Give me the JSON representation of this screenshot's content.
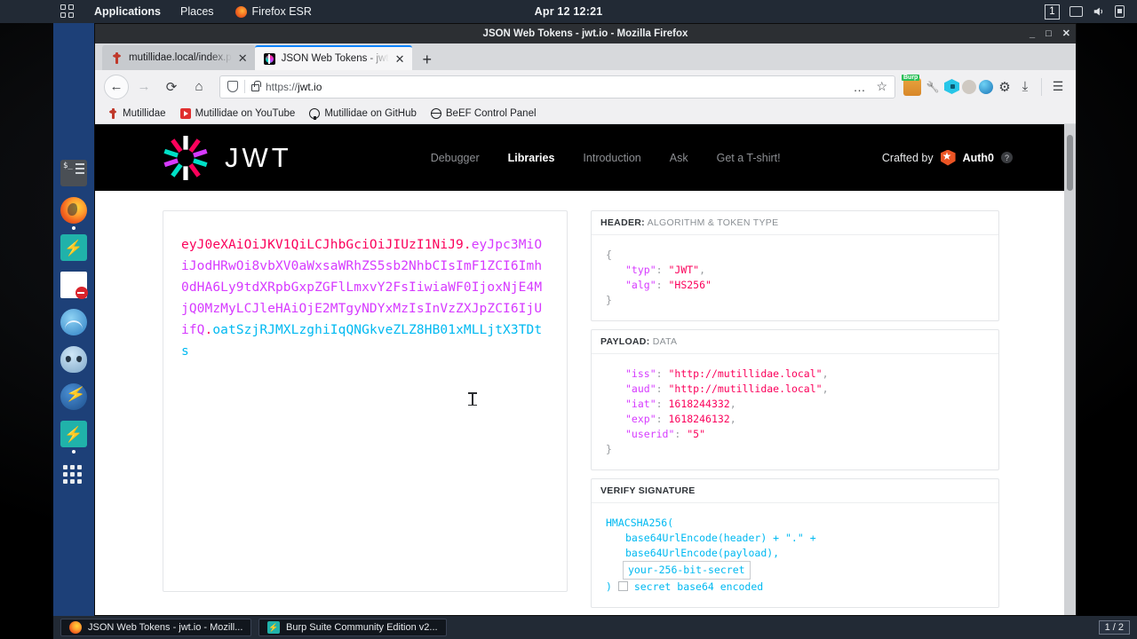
{
  "topbar": {
    "apps_icon": "apps-grid-icon",
    "menu_applications": "Applications",
    "menu_places": "Places",
    "menu_firefox": "Firefox ESR",
    "clock": "Apr 12  12:21",
    "workspace_badge": "1",
    "icons": [
      "display-icon",
      "volume-icon",
      "power-icon"
    ]
  },
  "dock": {
    "items": [
      {
        "name": "terminal",
        "label": "Terminal"
      },
      {
        "name": "firefox",
        "label": "Firefox ESR"
      },
      {
        "name": "burpsuite",
        "label": "Burp Suite"
      },
      {
        "name": "document-blocked",
        "label": "Document"
      },
      {
        "name": "wireshark",
        "label": "Wireshark"
      },
      {
        "name": "beef",
        "label": "BeEF"
      },
      {
        "name": "hydra",
        "label": "Hydra"
      },
      {
        "name": "burpsuite-2",
        "label": "Burp Suite"
      },
      {
        "name": "show-applications",
        "label": "Show Applications"
      }
    ]
  },
  "window": {
    "title": "JSON Web Tokens - jwt.io - Mozilla Firefox",
    "minimize": "_",
    "maximize": "□",
    "close": "✕"
  },
  "tabs": [
    {
      "title": "mutillidae.local/index.p",
      "favicon": "mutillidae-icon",
      "active": false
    },
    {
      "title": "JSON Web Tokens - jwt",
      "favicon": "jwt-icon",
      "active": true
    }
  ],
  "tab_new_label": "+",
  "navbar": {
    "back": "←",
    "forward": "→",
    "reload": "⟳",
    "home": "⌂",
    "url_scheme": "https://",
    "url_host": "jwt.io",
    "page_actions": "…",
    "bookmark_star": "☆",
    "extensions": [
      "burp-icon",
      "wrench-icon",
      "cube-icon",
      "cookie-icon",
      "globe-icon",
      "gear-icon",
      "download-icon"
    ],
    "app_menu": "☰"
  },
  "bookmarks": [
    {
      "label": "Mutillidae",
      "icon": "mutillidae-icon"
    },
    {
      "label": "Mutillidae on YouTube",
      "icon": "youtube-icon"
    },
    {
      "label": "Mutillidae on GitHub",
      "icon": "github-icon"
    },
    {
      "label": "BeEF Control Panel",
      "icon": "beef-icon"
    }
  ],
  "site": {
    "logo_word": "JWT",
    "nav": [
      {
        "label": "Debugger",
        "active": false
      },
      {
        "label": "Libraries",
        "active": true
      },
      {
        "label": "Introduction",
        "active": false
      },
      {
        "label": "Ask",
        "active": false
      },
      {
        "label": "Get a T-shirt!",
        "active": false
      }
    ],
    "crafted_by": "Crafted by",
    "brand": "Auth0",
    "help": "?"
  },
  "encoded": {
    "header_part": "eyJ0eXAiOiJKV1QiLCJhbGciOiJIUzI1NiJ9",
    "payload_part": "eyJpc3MiOiJodHRwOi8vbXV0aWxsaWRhZS5sb2NhbCIsImF1ZCI6Imh0dHA6Ly9tdXRpbGxpZGFlLmxvY2FsIiwiaWF0IjoxNjE4MjQ0MzMyLCJleHAiOjE2MTgyNDYxMzIsInVzZXJpZCI6IjUifQ",
    "signature_part": "oatSzjRJMXLzghiIqQNGkveZLZ8HB01xMLLjtX3TDts",
    "separator": "."
  },
  "decoded": {
    "header": {
      "title": "HEADER:",
      "subtitle": "ALGORITHM & TOKEN TYPE",
      "lines": [
        {
          "indent": 1,
          "text": "{",
          "kind": "brace"
        },
        {
          "indent": 2,
          "key": "\"typ\"",
          "value": "\"JWT\"",
          "kind": "string",
          "comma": true
        },
        {
          "indent": 2,
          "key": "\"alg\"",
          "value": "\"HS256\"",
          "kind": "string",
          "comma": false
        },
        {
          "indent": 1,
          "text": "}",
          "kind": "brace"
        }
      ]
    },
    "payload": {
      "title": "PAYLOAD:",
      "subtitle": "DATA",
      "lines": [
        {
          "indent": 2,
          "key": "\"iss\"",
          "value": "\"http://mutillidae.local\"",
          "kind": "string",
          "comma": true
        },
        {
          "indent": 2,
          "key": "\"aud\"",
          "value": "\"http://mutillidae.local\"",
          "kind": "string",
          "comma": true
        },
        {
          "indent": 2,
          "key": "\"iat\"",
          "value": "1618244332",
          "kind": "number",
          "comma": true
        },
        {
          "indent": 2,
          "key": "\"exp\"",
          "value": "1618246132",
          "kind": "number",
          "comma": true
        },
        {
          "indent": 2,
          "key": "\"userid\"",
          "value": "\"5\"",
          "kind": "string",
          "comma": false
        },
        {
          "indent": 1,
          "text": "}",
          "kind": "brace"
        }
      ]
    },
    "signature": {
      "title": "VERIFY SIGNATURE",
      "line1": "HMACSHA256(",
      "line2": "base64UrlEncode(header) + \".\" +",
      "line3": "base64UrlEncode(payload),",
      "secret_value": "your-256-bit-secret",
      "close_paren": ")",
      "checkbox_label": "secret base64 encoded"
    }
  },
  "taskbar": {
    "items": [
      {
        "label": "JSON Web Tokens - jwt.io - Mozill...",
        "icon": "firefox-icon"
      },
      {
        "label": "Burp Suite Community Edition v2...",
        "icon": "burp-icon"
      }
    ],
    "workspace": "1 / 2"
  },
  "colors": {
    "jwt_pink": "#fb015b",
    "jwt_purple": "#d63aff",
    "jwt_cyan": "#00b9f1",
    "kali_blue": "#1d4078",
    "panel_dark": "#222a35",
    "auth0_orange": "#eb5424",
    "tab_accent": "#0a84ff"
  }
}
